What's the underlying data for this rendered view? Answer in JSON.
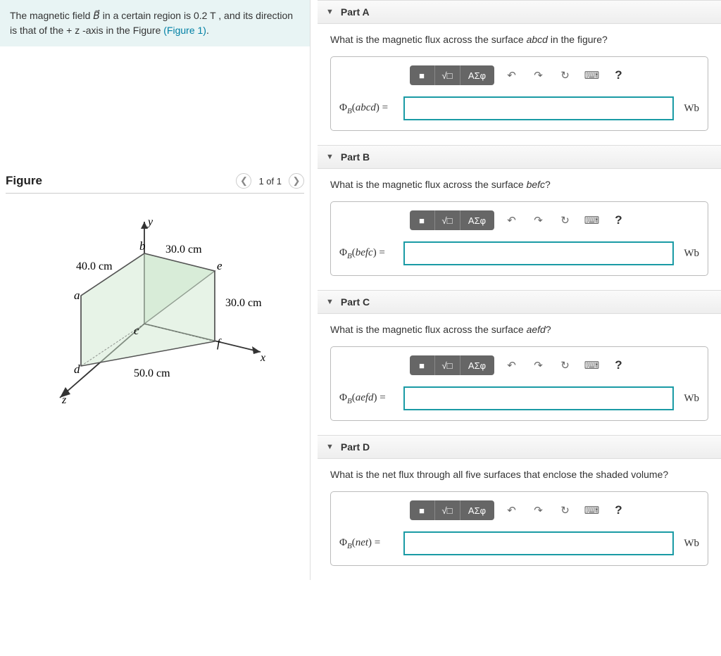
{
  "problem": {
    "text_pre": "The magnetic field ",
    "vector": "B⃗",
    "text_mid": " in a certain region is 0.2 T , and its direction is that of the + z -axis in the Figure ",
    "figure_link": "(Figure 1)",
    "text_post": "."
  },
  "figure": {
    "title": "Figure",
    "counter": "1 of 1",
    "dims": {
      "ab": "40.0 cm",
      "be": "30.0 cm",
      "ef": "30.0 cm",
      "cf": "50.0 cm"
    },
    "labels": {
      "a": "a",
      "b": "b",
      "c": "c",
      "d": "d",
      "e": "e",
      "f": "f",
      "x": "x",
      "y": "y",
      "z": "z"
    }
  },
  "toolbar": {
    "fraction_icon": "■",
    "root_icon": "√□",
    "greek_label": "ΑΣφ",
    "undo_icon": "↶",
    "redo_icon": "↷",
    "reset_icon": "↻",
    "keyboard_icon": "⌨",
    "help_icon": "?"
  },
  "parts": [
    {
      "title": "Part A",
      "question_pre": "What is the magnetic flux across the surface ",
      "surface": "abcd",
      "question_post": " in the figure?",
      "label_sub": "B",
      "label_paren": "abcd",
      "unit": "Wb"
    },
    {
      "title": "Part B",
      "question_pre": "What is the magnetic flux across the surface ",
      "surface": "befc",
      "question_post": "?",
      "label_sub": "B",
      "label_paren": "befc",
      "unit": "Wb"
    },
    {
      "title": "Part C",
      "question_pre": "What is the magnetic flux across the surface ",
      "surface": "aefd",
      "question_post": "?",
      "label_sub": "B",
      "label_paren": "aefd",
      "unit": "Wb"
    },
    {
      "title": "Part D",
      "question_pre": "What is the net flux through all five surfaces that enclose the shaded volume?",
      "surface": "",
      "question_post": "",
      "label_sub": "B",
      "label_paren": "net",
      "unit": "Wb"
    }
  ]
}
